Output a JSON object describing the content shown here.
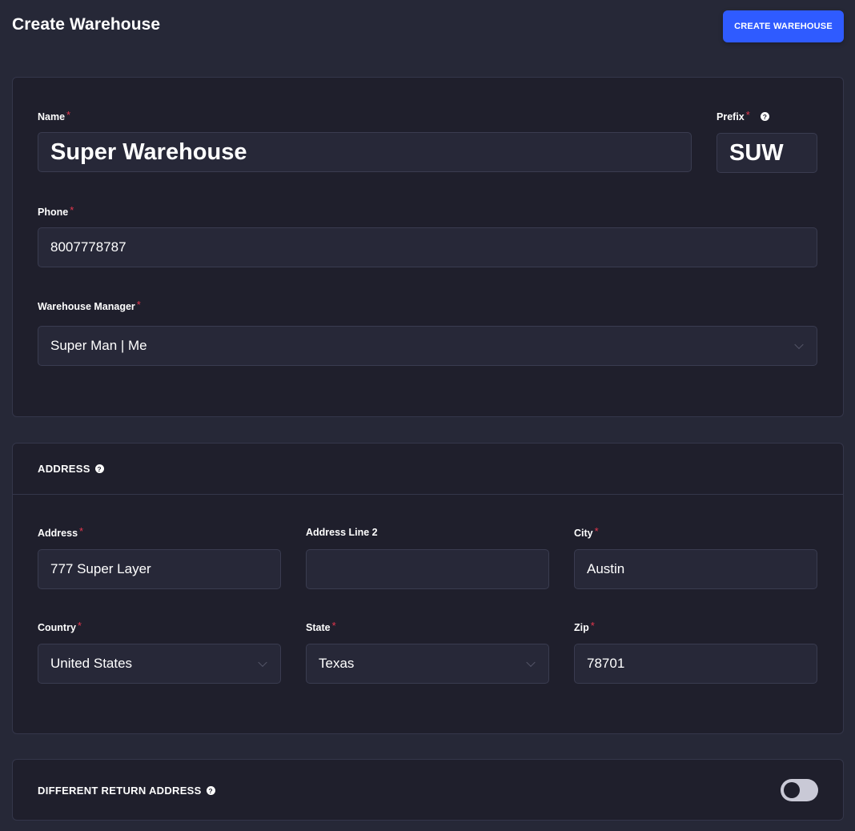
{
  "header": {
    "title": "Create Warehouse",
    "create_button": "CREATE WAREHOUSE"
  },
  "general": {
    "name_label": "Name",
    "name_value": "Super Warehouse",
    "prefix_label": "Prefix",
    "prefix_value": "SUW",
    "phone_label": "Phone",
    "phone_value": "8007778787",
    "manager_label": "Warehouse Manager",
    "manager_value": "Super Man | Me"
  },
  "address": {
    "section_title": "ADDRESS",
    "address_label": "Address",
    "address_value": "777 Super Layer",
    "address2_label": "Address Line 2",
    "address2_value": "",
    "city_label": "City",
    "city_value": "Austin",
    "country_label": "Country",
    "country_value": "United States",
    "state_label": "State",
    "state_value": "Texas",
    "zip_label": "Zip",
    "zip_value": "78701"
  },
  "return_address": {
    "section_title": "DIFFERENT RETURN ADDRESS",
    "enabled": false
  },
  "required_mark": "*",
  "help_glyph": "?",
  "colors": {
    "accent": "#2f5bff",
    "required": "#e5364d",
    "background": "#262837",
    "card": "#1f1f2c"
  }
}
